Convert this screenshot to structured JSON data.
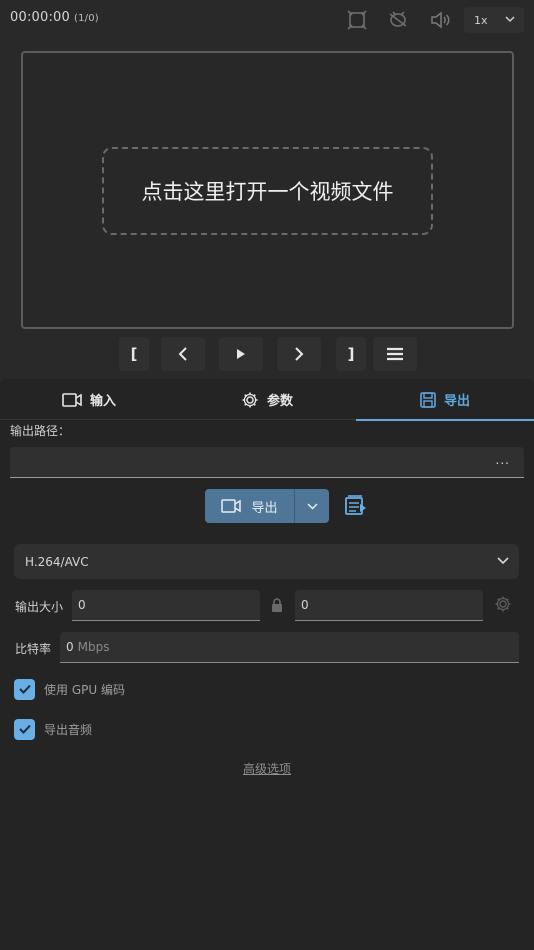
{
  "header": {
    "time": "00:00:00",
    "frame": "(1/0)",
    "speed": "1x",
    "icons": [
      "crop-icon",
      "magic-icon",
      "volume-icon"
    ]
  },
  "viewer": {
    "open_prompt": "点击这里打开一个视频文件"
  },
  "controls": {
    "mark_in": "[",
    "mark_out": "]"
  },
  "tabs": [
    {
      "label": "输入",
      "icon": "video-camera-icon"
    },
    {
      "label": "参数",
      "icon": "gear-icon"
    },
    {
      "label": "导出",
      "icon": "save-icon"
    }
  ],
  "export": {
    "path_label": "输出路径：",
    "path_value": "",
    "browse_label": "...",
    "export_button": "导出",
    "codec": "H.264/AVC",
    "size_label": "输出大小",
    "width": "0",
    "height": "0",
    "bitrate_label": "比特率",
    "bitrate_value": "0",
    "bitrate_unit": "Mbps",
    "gpu_label": "使用 GPU 编码",
    "gpu_checked": true,
    "audio_label": "导出音频",
    "audio_checked": true,
    "advanced_label": "高级选项"
  },
  "colors": {
    "accent": "#5fa8e0",
    "button": "#4f7597",
    "checkbox": "#6aaee6"
  }
}
